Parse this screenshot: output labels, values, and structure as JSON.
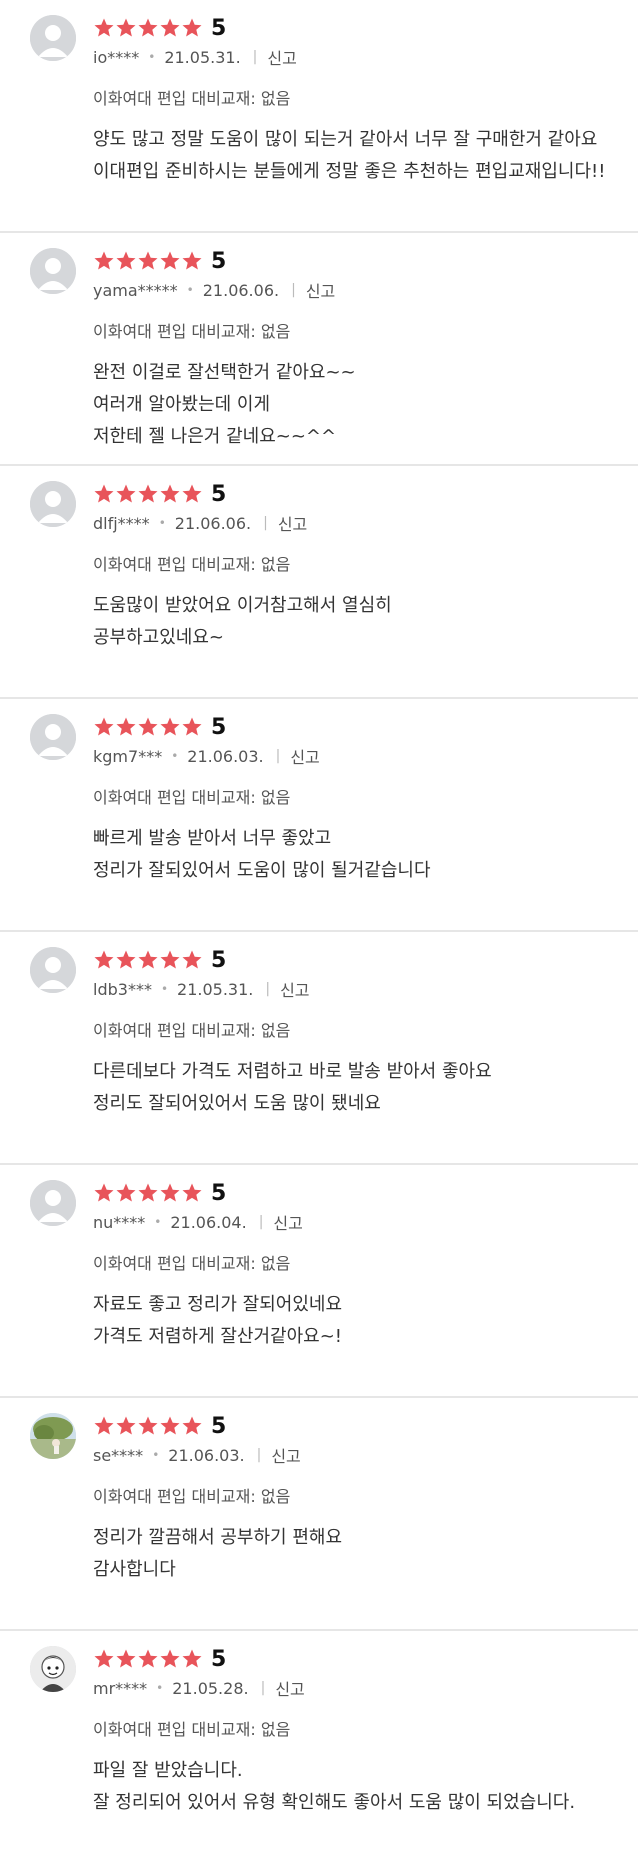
{
  "colors": {
    "star": "#e8545a",
    "divider": "#e6e6e6",
    "avatar_placeholder": "#d5d7da"
  },
  "reviews": [
    {
      "rating": "5",
      "user": "io****",
      "date": "21.05.31.",
      "report_label": "신고",
      "option_text": "이화여대 편입 대비교재: 없음",
      "avatar_icon": "default-user-icon",
      "lines": [
        "양도 많고 정말 도움이 많이 되는거 같아서 너무 잘 구매한거 같아요",
        "이대편입 준비하시는 분들에게 정말 좋은 추천하는 편입교재입니다!!"
      ]
    },
    {
      "rating": "5",
      "user": "yama*****",
      "date": "21.06.06.",
      "report_label": "신고",
      "option_text": "이화여대 편입 대비교재: 없음",
      "avatar_icon": "default-user-icon",
      "lines": [
        "완전 이걸로 잘선택한거 같아요~~",
        "여러개 알아봤는데 이게",
        "저한테 젤 나은거 같네요~~^^"
      ]
    },
    {
      "rating": "5",
      "user": "dlfj****",
      "date": "21.06.06.",
      "report_label": "신고",
      "option_text": "이화여대 편입 대비교재: 없음",
      "avatar_icon": "default-user-icon",
      "lines": [
        "도움많이 받았어요 이거참고해서 열심히",
        "공부하고있네요~"
      ]
    },
    {
      "rating": "5",
      "user": "kgm7***",
      "date": "21.06.03.",
      "report_label": "신고",
      "option_text": "이화여대 편입 대비교재: 없음",
      "avatar_icon": "default-user-icon",
      "lines": [
        "빠르게 발송 받아서 너무 좋았고",
        "정리가 잘되있어서 도움이 많이 될거같습니다"
      ]
    },
    {
      "rating": "5",
      "user": "ldb3***",
      "date": "21.05.31.",
      "report_label": "신고",
      "option_text": "이화여대 편입 대비교재: 없음",
      "avatar_icon": "default-user-icon",
      "lines": [
        "다른데보다 가격도 저렴하고 바로 발송 받아서 좋아요",
        "정리도 잘되어있어서 도움 많이 됐네요"
      ]
    },
    {
      "rating": "5",
      "user": "nu****",
      "date": "21.06.04.",
      "report_label": "신고",
      "option_text": "이화여대 편입 대비교재: 없음",
      "avatar_icon": "default-user-icon",
      "lines": [
        "자료도 좋고 정리가 잘되어있네요",
        "가격도 저렴하게 잘산거같아요~!"
      ]
    },
    {
      "rating": "5",
      "user": "se****",
      "date": "21.06.03.",
      "report_label": "신고",
      "option_text": "이화여대 편입 대비교재: 없음",
      "avatar_icon": "landscape-photo-icon",
      "lines": [
        "정리가 깔끔해서 공부하기 편해요",
        "감사합니다"
      ]
    },
    {
      "rating": "5",
      "user": "mr****",
      "date": "21.05.28.",
      "report_label": "신고",
      "option_text": "이화여대 편입 대비교재: 없음",
      "avatar_icon": "character-photo-icon",
      "lines": [
        "파일 잘 받았습니다.",
        "잘 정리되어 있어서 유형 확인해도 좋아서 도움 많이 되었습니다."
      ]
    }
  ]
}
